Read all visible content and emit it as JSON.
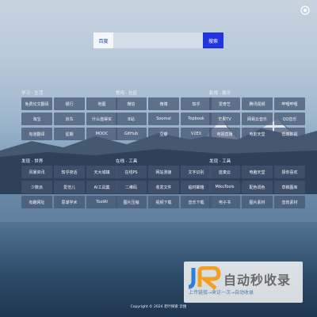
{
  "search": {
    "engine_label": "百度",
    "placeholder": "",
    "button_label": "搜索"
  },
  "sections": [
    {
      "title": "学习 · 生活",
      "items": [
        "免费论文翻译",
        "银行",
        "地图",
        "淘宝",
        "京东",
        "什么值得买",
        "有道翻译",
        "星期",
        "MOOC"
      ]
    },
    {
      "title": "常用 · 社区",
      "items": [
        "微信",
        "微博",
        "知乎",
        "B站",
        "Soomal",
        "Topbook",
        "GitHub",
        "豆瓣",
        "V2EX"
      ]
    },
    {
      "title": "影视 · 娱乐",
      "items": [
        "爱奇艺",
        "腾讯视频",
        "哔哩哔哩",
        "芒果TV",
        "网易云音乐",
        "QQ音乐",
        "电视直播",
        "电影天堂",
        "低端影视"
      ]
    },
    {
      "title": "发现 · 世界",
      "items": [
        "风暴资讯",
        "知乎夜话",
        "天大城镇",
        "少数派",
        "爱范儿",
        "AI工具集",
        "有趣网址",
        "思谋学术",
        "ToolAI"
      ]
    },
    {
      "title": "在线 · 工具",
      "items": [
        "在线PS",
        "网站测速",
        "文字识别",
        "二维码",
        "收发文件",
        "临时邮箱",
        "图片压缩",
        "视频下载",
        "音乐下载"
      ]
    },
    {
      "title": "发现 · 工具",
      "items": [
        "蓝奏云",
        "电脑天堂",
        "猜你喜欢",
        "MikuTools",
        "配色调色",
        "草稿图库",
        "电子书",
        "图片素材",
        "音效素材"
      ]
    }
  ],
  "footer": {
    "text": "Copyright © 2024 老叶探索 云搜"
  },
  "watermark": {
    "title": "自动秒收录",
    "subtitle": "上传链接→来访一次→自动收录"
  },
  "colors": {
    "search_button": "#2233e0",
    "tile_bg": "rgba(68,84,112,0.72)"
  },
  "icons": {
    "settings": "settings-icon",
    "logo": "jr-logo-icon"
  }
}
